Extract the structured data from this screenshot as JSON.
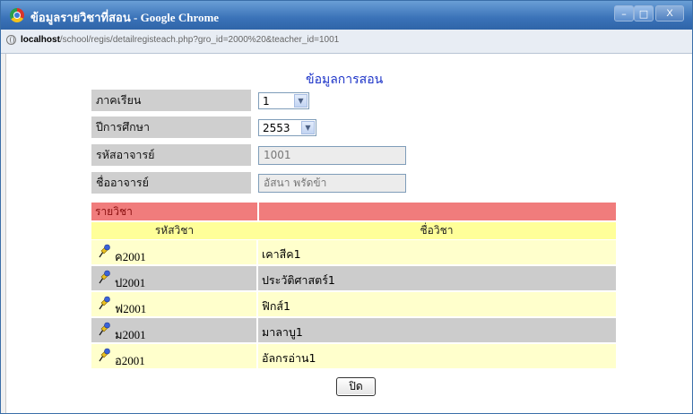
{
  "window": {
    "title": "ข้อมูลรายวิชาที่สอน - Google Chrome",
    "controls": {
      "minimize": "–",
      "maximize": "□",
      "close": "X"
    }
  },
  "address": {
    "host": "localhost",
    "path": "/school/regis/detailregisteach.php?gro_id=2000%20&teacher_id=1001"
  },
  "page": {
    "heading": "ข้อมูลการสอน",
    "form": {
      "semester_label": "ภาคเรียน",
      "semester_value": "1",
      "year_label": "ปีการศึกษา",
      "year_value": "2553",
      "teacher_code_label": "รหัสอาจารย์",
      "teacher_code_value": "1001",
      "teacher_name_label": "ชื่ออาจารย์",
      "teacher_name_value": "อัสนา พรัดข้า"
    },
    "subjects": {
      "section_label": "รายวิชา",
      "col_code": "รหัสวิชา",
      "col_name": "ชื่อวิชา",
      "rows": [
        {
          "code": "ค2001",
          "name": "เคาสีค1",
          "icon": "pushpin-icon"
        },
        {
          "code": "ป2001",
          "name": "ประวัติศาสตร์1",
          "icon": "pushpin-icon"
        },
        {
          "code": "ฟ2001",
          "name": "ฟิกส์1",
          "icon": "pushpin-icon"
        },
        {
          "code": "ม2001",
          "name": "มาลาบู1",
          "icon": "pushpin-icon"
        },
        {
          "code": "อ2001",
          "name": "อัลกรอ่าน1",
          "icon": "pushpin-icon"
        }
      ]
    },
    "close_button": "ปิด"
  },
  "colors": {
    "title_bar": "#3a72b8",
    "heading": "#1c33c8",
    "label_bg": "#cfcfcf",
    "section_bg": "#f07c7c",
    "header_bg": "#ffff99",
    "row_light": "#ffffcc",
    "row_dark": "#cccccc"
  }
}
